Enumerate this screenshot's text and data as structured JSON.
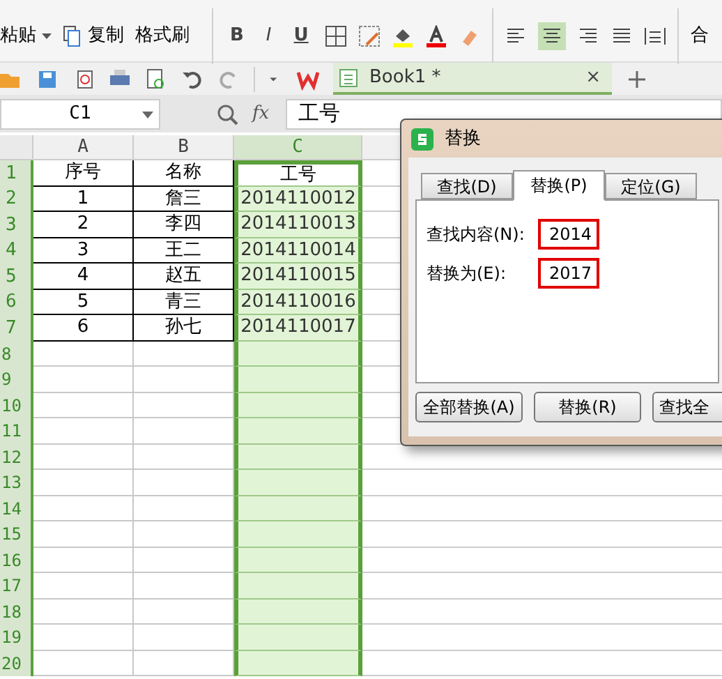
{
  "ribbon": {
    "paste": "粘贴",
    "copy": "复制",
    "format_painter": "格式刷",
    "bold": "B",
    "italic": "I",
    "underline": "U",
    "merge": "合"
  },
  "toolbar": {
    "doc_tab": "Book1 *",
    "close": "×"
  },
  "formula_bar": {
    "name_box": "C1",
    "fx": "fx",
    "value": "工号"
  },
  "sheet": {
    "columns": [
      {
        "label": "A",
        "selected": false
      },
      {
        "label": "B",
        "selected": false
      },
      {
        "label": "C",
        "selected": true
      }
    ],
    "rows": [
      {
        "label": "1",
        "cells": [
          "序号",
          "名称",
          "工号"
        ]
      },
      {
        "label": "2",
        "cells": [
          "1",
          "詹三",
          "2014110012"
        ]
      },
      {
        "label": "3",
        "cells": [
          "2",
          "李四",
          "2014110013"
        ]
      },
      {
        "label": "4",
        "cells": [
          "3",
          "王二",
          "2014110014"
        ]
      },
      {
        "label": "5",
        "cells": [
          "4",
          "赵五",
          "2014110015"
        ]
      },
      {
        "label": "6",
        "cells": [
          "5",
          "青三",
          "2014110016"
        ]
      },
      {
        "label": "7",
        "cells": [
          "6",
          "孙七",
          "2014110017"
        ]
      }
    ],
    "empty_rows": [
      "8",
      "9",
      "10",
      "11",
      "12",
      "13",
      "14",
      "15",
      "16",
      "17",
      "18",
      "19",
      "20"
    ]
  },
  "dialog": {
    "title": "替换",
    "tabs": [
      {
        "label": "查找(D)",
        "selected": false
      },
      {
        "label": "替换(P)",
        "selected": true
      },
      {
        "label": "定位(G)",
        "selected": false
      }
    ],
    "fields": [
      {
        "label": "查找内容(N):",
        "value": "2014",
        "highlighted": true
      },
      {
        "label": "替换为(E):",
        "value": "2017",
        "highlighted": true
      }
    ],
    "buttons": [
      "全部替换(A)",
      "替换(R)",
      "查找全"
    ]
  }
}
